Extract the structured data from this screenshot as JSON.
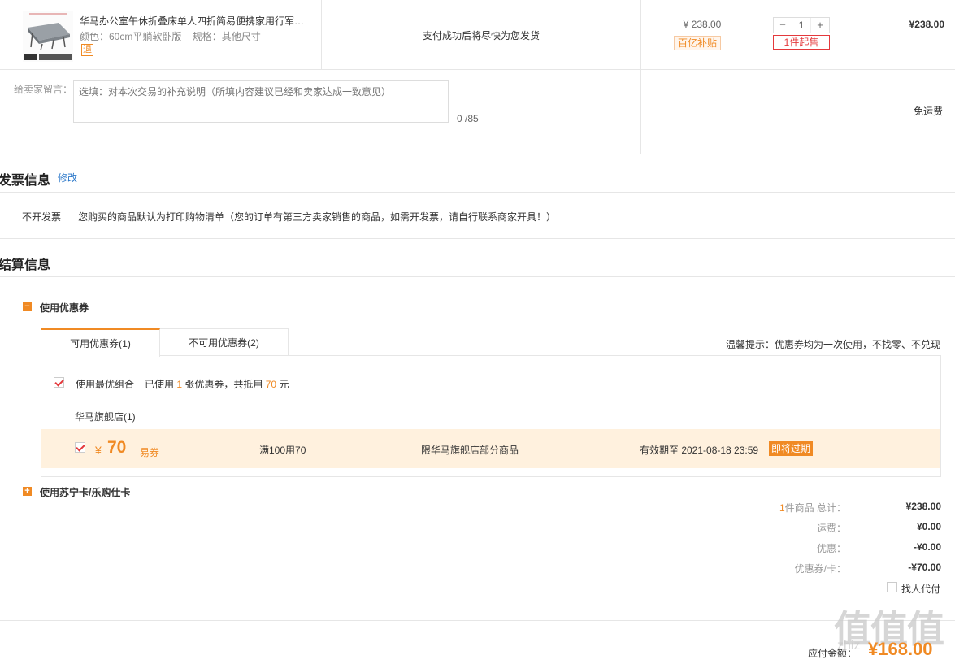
{
  "product": {
    "title": "华马办公室午休折叠床单人四折简易便携家用行军…",
    "color": "颜色：60cm平躺软卧版",
    "spec": "规格：其他尺寸",
    "refund_icon": "退",
    "ship_msg": "支付成功后将尽快为您发货",
    "price": "¥ 238.00",
    "subsidy": "百亿补贴",
    "qty": "1",
    "minus": "−",
    "plus": "+",
    "min_buy": "1件起售",
    "total": "¥238.00"
  },
  "message": {
    "label": "给卖家留言：",
    "placeholder": "选填：对本次交易的补充说明（所填内容建议已经和卖家达成一致意见）",
    "count": "0 /85",
    "shipping": "免运费"
  },
  "invoice": {
    "title": "发票信息",
    "edit": "修改",
    "type": "不开发票",
    "desc": "您购买的商品默认为打印购物清单（您的订单有第三方卖家销售的商品，如需开发票，请自行联系商家开具！）"
  },
  "settlement": {
    "title": "结算信息",
    "coupon_section": "使用优惠券",
    "collapse_icon": "−",
    "tabs": [
      "可用优惠券(1)",
      "不可用优惠券(2)"
    ],
    "tip": "温馨提示：优惠券均为一次使用，不找零、不兑现",
    "best_combo": "使用最优组合",
    "used_prefix": "已使用",
    "used_count": "1",
    "used_mid": "张优惠券，共抵用",
    "used_amount": "70",
    "used_suffix": "元",
    "store": "华马旗舰店(1)",
    "coupon": {
      "currency": "¥",
      "amount": "70",
      "type": "易券",
      "condition": "满100用70",
      "scope": "限华马旗舰店部分商品",
      "expiry": "有效期至 2021-08-18 23:59",
      "badge": "即将过期"
    },
    "card_section": "使用苏宁卡/乐购仕卡",
    "expand_icon": "+"
  },
  "summary": {
    "items_count": "1",
    "items_label": "件商品 总计：",
    "items_total": "¥238.00",
    "shipping_label": "运费：",
    "shipping": "¥0.00",
    "discount_label": "优惠：",
    "discount": "-¥0.00",
    "coupon_label": "优惠券/卡：",
    "coupon": "-¥70.00",
    "proxy_pay": "找人代付",
    "pay_label": "应付金额：",
    "pay_amount": "¥168.00"
  },
  "watermark": {
    "logo": "值值值",
    "domain": "zhiz"
  },
  "colors": {
    "accent": "#f08a24",
    "red": "#e4393c",
    "link": "#2a77c9",
    "coupon_bg": "#fff1de"
  }
}
